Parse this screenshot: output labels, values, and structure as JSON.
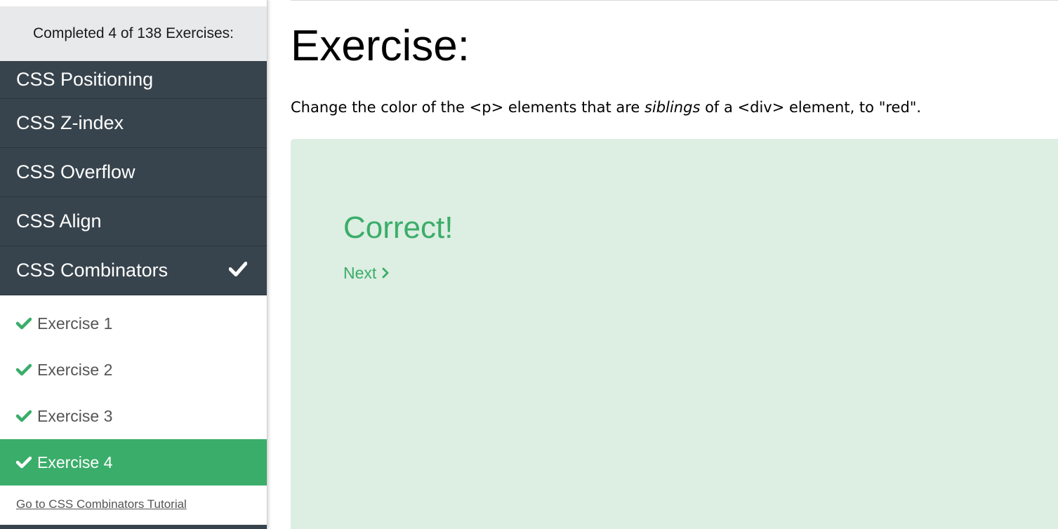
{
  "sidebar": {
    "progress_text": "Completed 4 of 138 Exercises:",
    "topics": [
      {
        "label": "CSS Positioning"
      },
      {
        "label": "CSS Z-index"
      },
      {
        "label": "CSS Overflow"
      },
      {
        "label": "CSS Align"
      },
      {
        "label": "CSS Combinators",
        "completed": true
      }
    ],
    "exercises": [
      {
        "label": "Exercise 1",
        "completed": true
      },
      {
        "label": "Exercise 2",
        "completed": true
      },
      {
        "label": "Exercise 3",
        "completed": true
      },
      {
        "label": "Exercise 4",
        "completed": true,
        "active": true
      }
    ],
    "tutorial_link": "Go to CSS Combinators Tutorial"
  },
  "main": {
    "title": "Exercise:",
    "instruction": {
      "part1": "Change the color of the <p> elements that are ",
      "emphasis": "siblings",
      "part2": " of a <div> element, to \"red\"."
    },
    "result": {
      "title": "Correct!",
      "next_label": "Next"
    }
  },
  "colors": {
    "sidebar_dark": "#38444d",
    "accent_green": "#3aad6a",
    "result_bg": "#ddeee2",
    "progress_bg": "#e8e9ea"
  },
  "icons": {
    "check": "check-icon",
    "next": "chevron-right-icon"
  }
}
